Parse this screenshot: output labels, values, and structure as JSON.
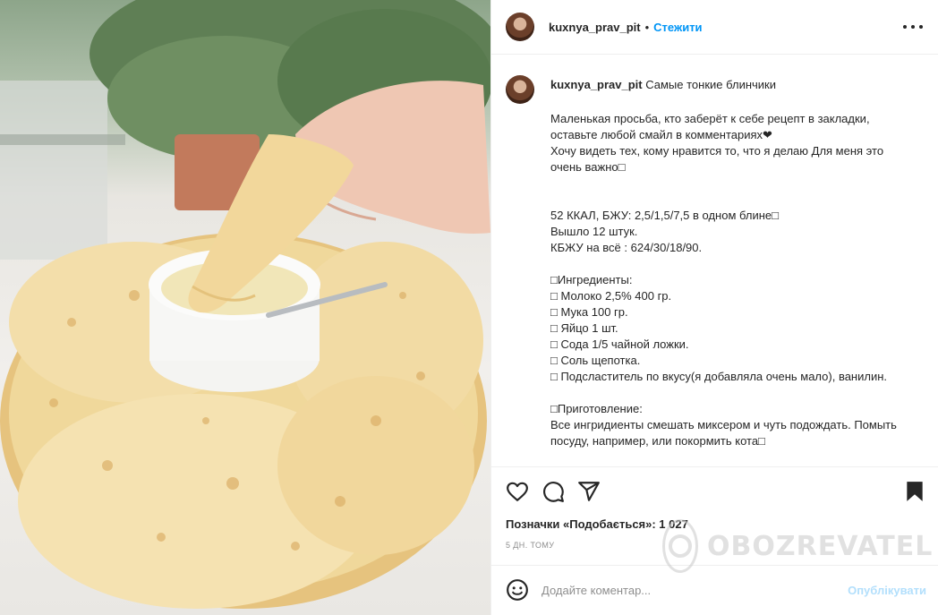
{
  "post": {
    "username": "kuxnya_prav_pit",
    "separator": "•",
    "follow_label": "Стежити",
    "more_icon": "more-options-icon"
  },
  "caption": {
    "username": "kuxnya_prav_pit",
    "title": "Самые тонкие блинчики",
    "lines": [
      "Маленькая просьба, кто заберёт к себе рецепт в закладки,",
      "оставьте любой смайл в комментариях❤",
      "Хочу видеть тех, кому нравится то, что я делаю Для меня это",
      "очень важно□",
      "",
      "",
      "52 ККАЛ, БЖУ: 2,5/1,5/7,5 в одном блине□",
      "Вышло 12 штук.",
      "КБЖУ на всё : 624/30/18/90.",
      "",
      "□Ингредиенты:",
      "□ Молоко 2,5% 400 гр.",
      "□ Мука 100 гр.",
      "□ Яйцо 1 шт.",
      "□ Сода 1/5 чайной ложки.",
      "□ Соль щепотка.",
      "□ Подсластитель по вкусу(я добавляла очень мало), ванилин.",
      "",
      "□Приготовление:",
      "Все ингридиенты смешать миксером и чуть подождать. Помыть",
      "посуду, например, или покормить кота□"
    ]
  },
  "actions": {
    "like_icon": "heart-icon",
    "comment_icon": "comment-icon",
    "share_icon": "share-icon",
    "save_icon": "bookmark-icon"
  },
  "likes_text": "Позначки «Подобається»: 1 027",
  "time_ago": "5 дн. тому",
  "comment": {
    "emoji_icon": "emoji-icon",
    "placeholder": "Додайте коментар...",
    "post_label": "Опублікувати"
  },
  "watermark": {
    "text": "OBOZREVATEL"
  },
  "colors": {
    "accent": "#0095f6",
    "post_disabled": "#b2dffc",
    "text": "#262626",
    "muted": "#8e8e8e"
  }
}
